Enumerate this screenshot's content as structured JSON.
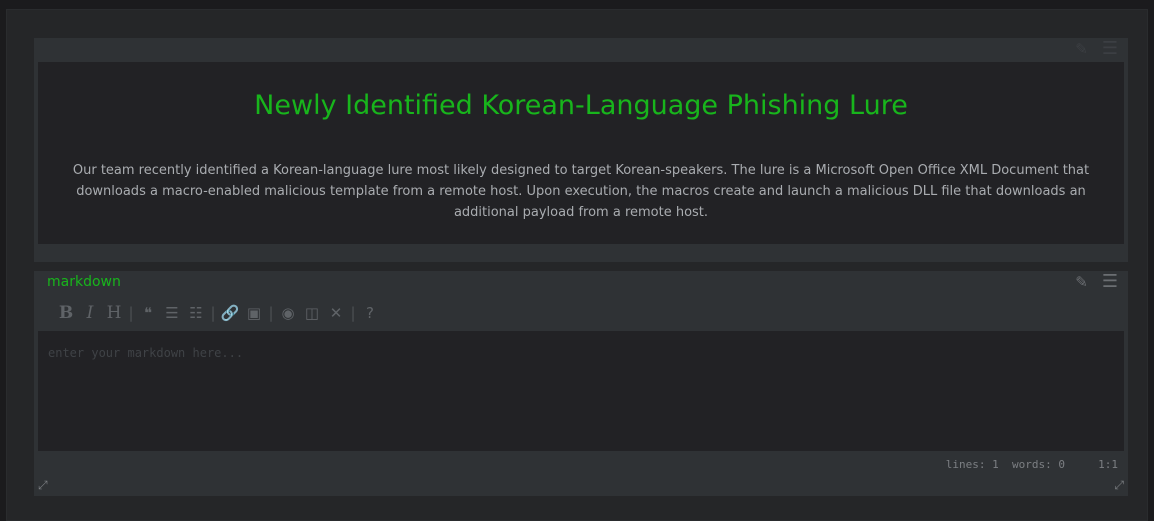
{
  "panel1": {
    "title": "Newly Identified Korean-Language Phishing Lure",
    "body": "Our team recently identified a Korean-language lure most likely designed to target Korean-speakers. The lure is a Microsoft Open Office XML Document that downloads a macro-enabled malicious template from a remote host. Upon execution, the macros create and launch a malicious DLL file that downloads an additional payload from a remote host."
  },
  "panel2": {
    "label": "markdown",
    "toolbar": {
      "bold": "B",
      "italic": "I",
      "heading": "H",
      "quote": "❝",
      "ul": "☰",
      "ol": "☷",
      "link": "🔗",
      "image": "▣",
      "preview": "◉",
      "side": "◫",
      "fullscreen": "✕",
      "guide": "?"
    },
    "editor_value": "",
    "editor_placeholder": "enter your markdown here...",
    "status": {
      "lines": "lines: 1",
      "words": "words: 0",
      "cursor": "1:1"
    }
  },
  "icons": {
    "pencil": "✎",
    "menu": "☰",
    "resize": "⤢"
  },
  "colors": {
    "accent": "#18b51c",
    "background": "#1b1b1d",
    "panel": "#2f3235",
    "content": "#222225"
  }
}
